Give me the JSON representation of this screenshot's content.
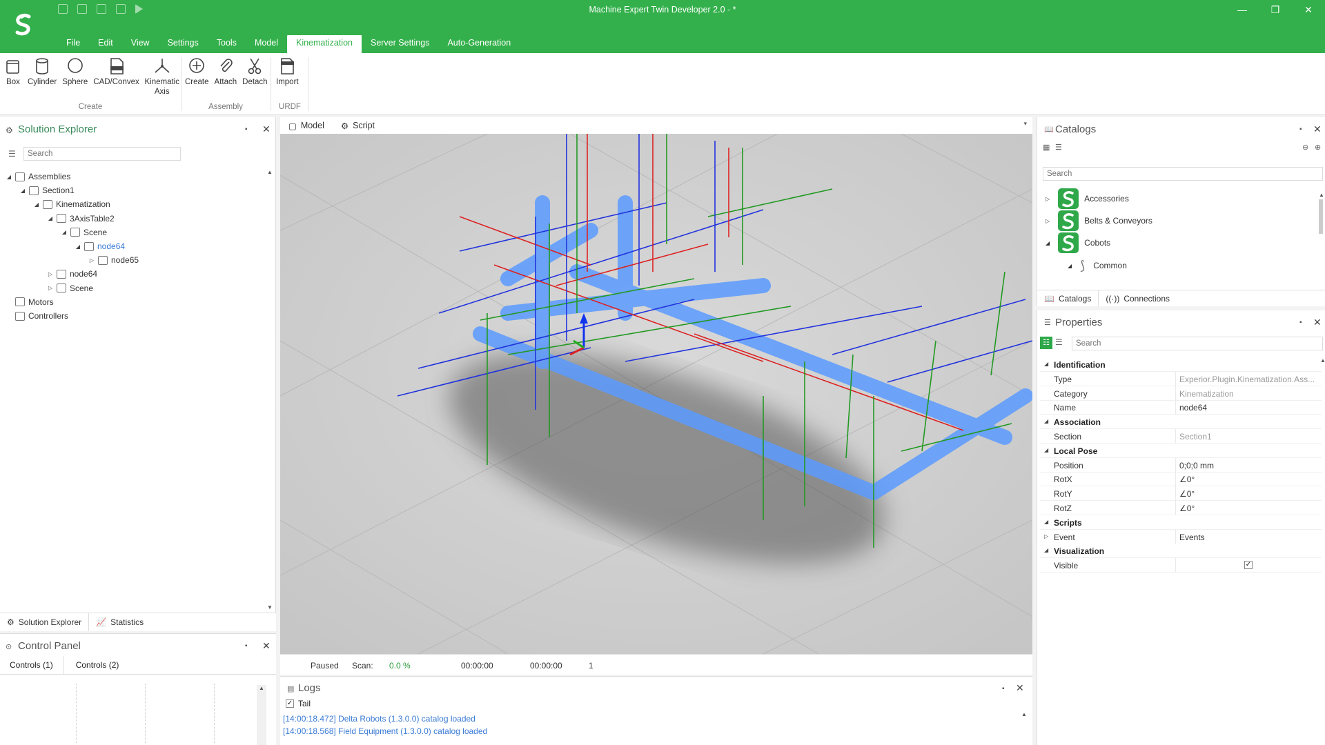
{
  "window": {
    "title": "Machine Expert Twin Developer 2.0 - *",
    "accent": "#33b04b"
  },
  "menu": {
    "items": [
      "File",
      "Edit",
      "View",
      "Settings",
      "Tools",
      "Model",
      "Kinematization",
      "Server Settings",
      "Auto-Generation"
    ],
    "active": "Kinematization"
  },
  "ribbon": {
    "create": {
      "buttons": [
        "Box",
        "Cylinder",
        "Sphere",
        "CAD/Convex",
        "Kinematic Axis"
      ],
      "group": "Create"
    },
    "assembly": {
      "buttons": [
        "Create",
        "Attach",
        "Detach"
      ],
      "group": "Assembly"
    },
    "urdf": {
      "buttons": [
        "Import"
      ],
      "group": "URDF"
    }
  },
  "solution_explorer": {
    "title": "Solution Explorer",
    "search_placeholder": "Search",
    "tree": [
      {
        "label": "Assemblies",
        "depth": 0,
        "toggle": "◢"
      },
      {
        "label": "Section1",
        "depth": 1,
        "toggle": "◢"
      },
      {
        "label": "Kinematization",
        "depth": 2,
        "toggle": "◢"
      },
      {
        "label": "3AxisTable2",
        "depth": 3,
        "toggle": "◢"
      },
      {
        "label": "Scene",
        "depth": 4,
        "toggle": "◢"
      },
      {
        "label": "node64",
        "depth": 5,
        "toggle": "◢",
        "selected": true
      },
      {
        "label": "node65",
        "depth": 6,
        "toggle": "▷"
      },
      {
        "label": "node64",
        "depth": 3,
        "toggle": "▷"
      },
      {
        "label": "Scene",
        "depth": 3,
        "toggle": "▷"
      },
      {
        "label": "Motors",
        "depth": 0,
        "toggle": ""
      },
      {
        "label": "Controllers",
        "depth": 0,
        "toggle": ""
      }
    ],
    "tabs": [
      "Solution Explorer",
      "Statistics"
    ]
  },
  "control_panel": {
    "title": "Control Panel",
    "tabs": [
      "Controls (1)",
      "Controls (2)"
    ]
  },
  "viewport": {
    "tabs": [
      "Model",
      "Script"
    ]
  },
  "status": {
    "state": "Paused",
    "scan_label": "Scan:",
    "scan_value": "0.0 %",
    "time1": "00:00:00",
    "time2": "00:00:00",
    "count": "1"
  },
  "logs": {
    "title": "Logs",
    "tail_label": "Tail",
    "lines": [
      "[14:00:18.472] Delta Robots (1.3.0.0) catalog loaded",
      "[14:00:18.568] Field Equipment (1.3.0.0) catalog loaded"
    ]
  },
  "catalogs": {
    "title": "Catalogs",
    "search_placeholder": "Search",
    "items": [
      "Accessories",
      "Belts & Conveyors",
      "Cobots"
    ],
    "sub_item": "Common",
    "tabs": [
      "Catalogs",
      "Connections"
    ]
  },
  "properties": {
    "title": "Properties",
    "search_placeholder": "Search",
    "rows": [
      {
        "kind": "cat",
        "name": "Identification"
      },
      {
        "kind": "prop",
        "name": "Type",
        "value": "Experior.Plugin.Kinematization.Ass...",
        "gray": true
      },
      {
        "kind": "prop",
        "name": "Category",
        "value": "Kinematization",
        "gray": true
      },
      {
        "kind": "prop",
        "name": "Name",
        "value": "node64"
      },
      {
        "kind": "cat",
        "name": "Association"
      },
      {
        "kind": "prop",
        "name": "Section",
        "value": "Section1",
        "gray": true
      },
      {
        "kind": "cat",
        "name": "Local Pose"
      },
      {
        "kind": "prop",
        "name": "Position",
        "value": "0;0;0 mm"
      },
      {
        "kind": "prop",
        "name": "RotX",
        "value": "∠0°"
      },
      {
        "kind": "prop",
        "name": "RotY",
        "value": "∠0°"
      },
      {
        "kind": "prop",
        "name": "RotZ",
        "value": "∠0°"
      },
      {
        "kind": "cat",
        "name": "Scripts"
      },
      {
        "kind": "prop",
        "name": "Event",
        "value": "Events",
        "expand": true
      },
      {
        "kind": "cat",
        "name": "Visualization"
      },
      {
        "kind": "prop",
        "name": "Visible",
        "value": "",
        "checked": true
      }
    ]
  }
}
